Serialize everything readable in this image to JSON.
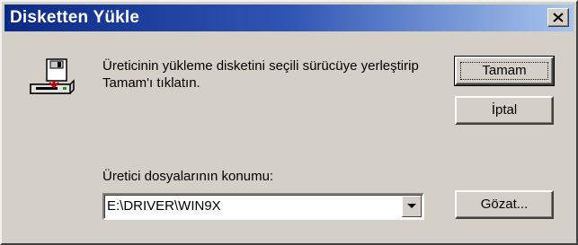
{
  "window": {
    "title": "Disketten Yükle"
  },
  "message": {
    "text": "Üreticinin yükleme disketini seçili sürücüye yerleştirip Tamam'ı tıklatın."
  },
  "buttons": {
    "ok_label": "Tamam",
    "cancel_label": "İptal",
    "browse_label": "Gözat..."
  },
  "location": {
    "label": "Üretici dosyalarının konumu:",
    "value": "E:\\DRIVER\\WIN9X"
  },
  "icons": {
    "disk": "floppy-drive-icon",
    "close": "close-icon",
    "dropdown": "chevron-down-icon"
  },
  "colors": {
    "titlebar_start": "#0b2a86",
    "titlebar_end": "#a9c6ee",
    "face": "#d4d0c8"
  }
}
